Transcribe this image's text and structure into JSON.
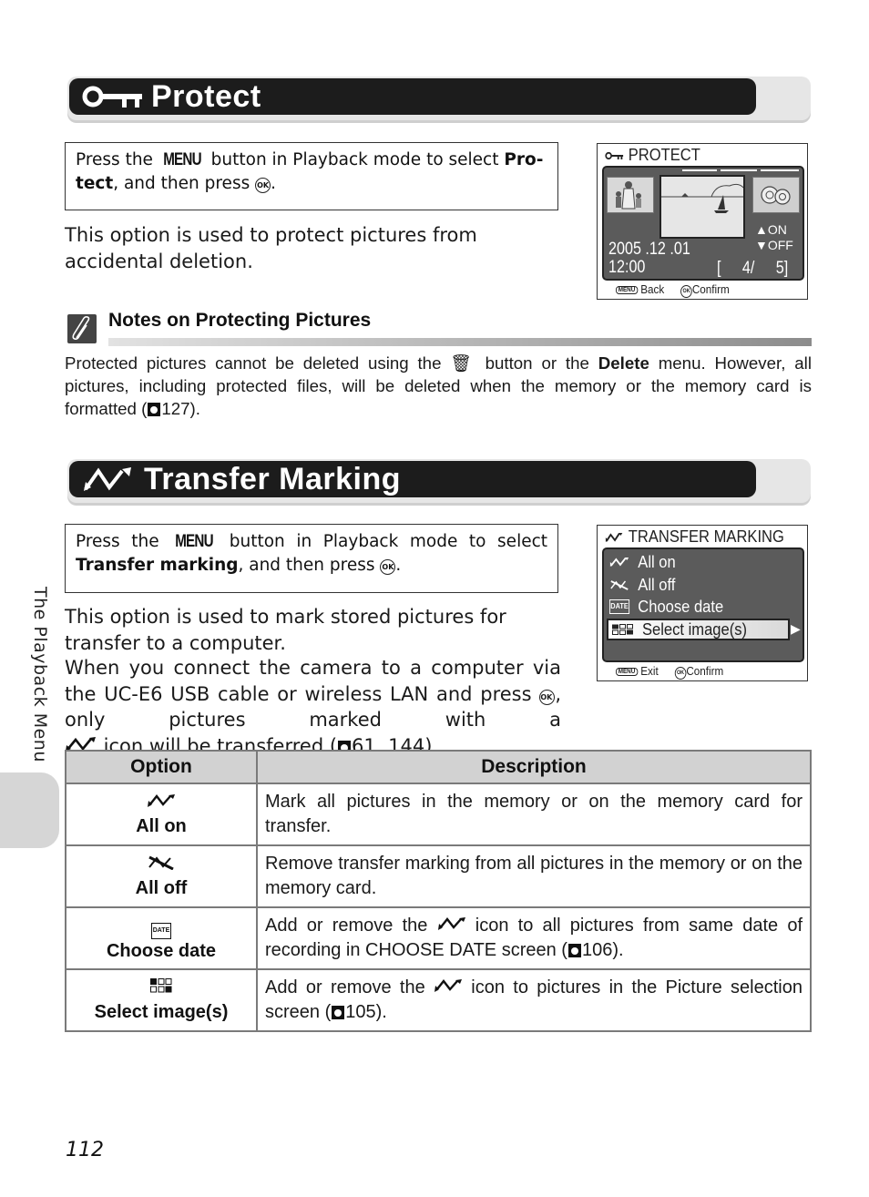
{
  "sections": {
    "protect": {
      "title": "Protect",
      "instruction": {
        "pre": "Press the ",
        "menu": "MENU",
        "mid": " button in Playback mode to select ",
        "bold": "Pro-tect",
        "post": ", and then press ",
        "ok": "OK",
        "end": "."
      },
      "body": "This option is used to protect pictures from accidental deletion.",
      "screen": {
        "title": "PROTECT",
        "date": "2005 .12 .01",
        "time": "12:00",
        "counter_open": "[",
        "counter_current": "4/",
        "counter_total": "5]",
        "on_label": "ON",
        "off_label": "OFF",
        "footer_back_btn": "MENU",
        "footer_back": "Back",
        "footer_confirm_btn": "OK",
        "footer_confirm": "Confirm"
      },
      "notes": {
        "title": "Notes on Protecting Pictures",
        "text_1": "Protected pictures cannot be deleted using the ",
        "text_2": " button or the ",
        "text_bold": "Delete",
        "text_3": " menu. However, all pictures, including protected files, will be deleted when the memory or the memory card is formatted (",
        "ref_page": "127",
        "text_4": ")."
      }
    },
    "transfer": {
      "title": "Transfer Marking",
      "instruction": {
        "pre": "Press the ",
        "menu": "MENU",
        "mid": " button in Playback mode to select ",
        "bold": "Transfer marking",
        "post": ", and then press ",
        "ok": "OK",
        "end": "."
      },
      "body_1": "This option is used to mark stored pictures for transfer to a computer.",
      "body_2a": "When you connect the camera to a computer via the UC-E6 USB cable or wireless LAN and press ",
      "body_2b": ", only pictures marked with a ",
      "body_2c": " icon will be transferred (",
      "body_2_refs": "61, 144",
      "body_2d": ").",
      "screen": {
        "title": "TRANSFER MARKING",
        "items": [
          {
            "icon": "transfer-on-icon",
            "label": "All on"
          },
          {
            "icon": "transfer-off-icon",
            "label": "All off"
          },
          {
            "icon": "date-icon",
            "label": "Choose date"
          },
          {
            "icon": "select-images-icon",
            "label": "Select image(s)",
            "selected": true
          }
        ],
        "footer_exit_btn": "MENU",
        "footer_exit": "Exit",
        "footer_confirm_btn": "OK",
        "footer_confirm": "Confirm"
      },
      "table": {
        "headers": [
          "Option",
          "Description"
        ],
        "rows": [
          {
            "icon": "transfer-on-icon",
            "option": "All on",
            "description": "Mark all pictures in the memory or on the memory card for transfer."
          },
          {
            "icon": "transfer-off-icon",
            "option": "All off",
            "description": "Remove transfer marking from all pictures in the memory or on the memory card."
          },
          {
            "icon": "date-icon",
            "option": "Choose date",
            "desc_a": "Add or remove the ",
            "desc_b": " icon to all pictures from same date of recording in CHOOSE DATE screen (",
            "ref": "106",
            "desc_c": ")."
          },
          {
            "icon": "select-images-icon",
            "option": "Select image(s)",
            "desc_a": "Add or remove the ",
            "desc_b": " icon to pictures in the Picture selection screen (",
            "ref": "105",
            "desc_c": ")."
          }
        ]
      }
    }
  },
  "side_tab": "The Playback Menu",
  "page_number": "112"
}
